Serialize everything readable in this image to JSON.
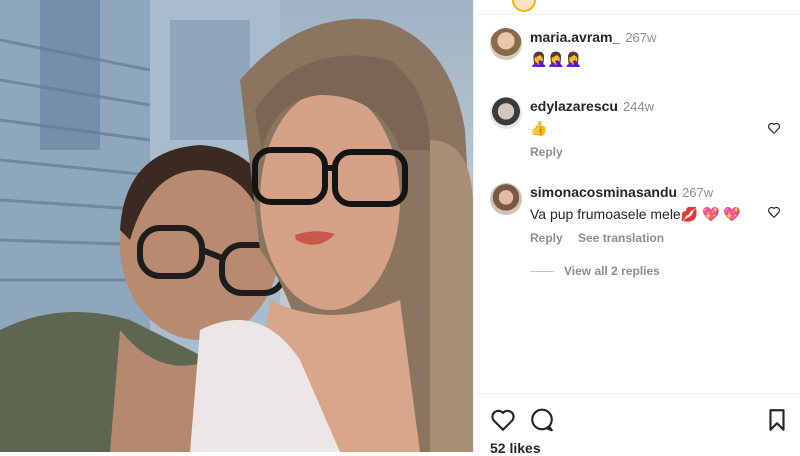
{
  "post": {
    "author": "maria.avram_",
    "time": "267w",
    "caption": "🤦‍♀️🤦‍♀️🤦‍♀️",
    "likes": "52 likes"
  },
  "comments": [
    {
      "user": "edylazarescu",
      "time": "244w",
      "text": "👍",
      "reply_label": "Reply"
    },
    {
      "user": "simonacosminasandu",
      "time": "267w",
      "text": "Va pup frumoasele mele💋 💖 💖",
      "reply_label": "Reply",
      "translate_label": "See translation",
      "view_replies": "View all 2 replies"
    }
  ],
  "icons": {
    "like": "heart-outline-icon",
    "comment": "comment-bubble-icon",
    "save": "bookmark-icon"
  }
}
